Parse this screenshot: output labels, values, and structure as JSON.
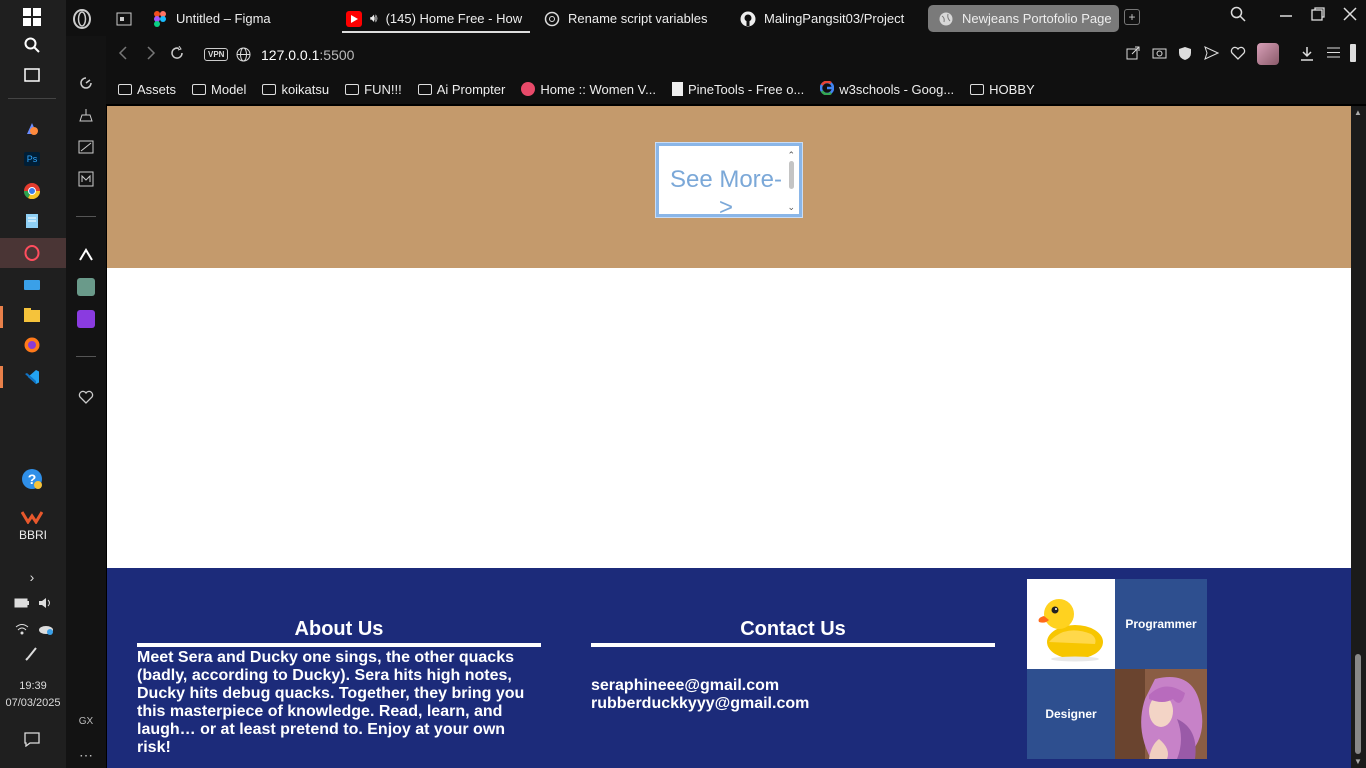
{
  "taskbar": {
    "time": "19:39",
    "date": "07/03/2025",
    "bbri_label": "BBRI"
  },
  "browser": {
    "tabs": [
      {
        "label": "Untitled – Figma",
        "icon": "figma-icon"
      },
      {
        "label": "(145) Home Free - How",
        "icon": "youtube-icon"
      },
      {
        "label": "Rename script variables",
        "icon": "chatgpt-icon"
      },
      {
        "label": "MalingPangsit03/Project",
        "icon": "github-icon"
      },
      {
        "label": "Newjeans Portofolio Page",
        "icon": "globe-icon"
      }
    ],
    "address": {
      "vpn": "VPN",
      "host": "127.0.0.1",
      "port": ":5500"
    },
    "bookmarks": [
      {
        "label": "Assets",
        "icon": "folder-icon"
      },
      {
        "label": "Model",
        "icon": "folder-icon"
      },
      {
        "label": "koikatsu",
        "icon": "folder-icon"
      },
      {
        "label": "FUN!!!",
        "icon": "folder-icon"
      },
      {
        "label": "Ai Prompter",
        "icon": "folder-icon"
      },
      {
        "label": "Home :: Women V...",
        "icon": "site-icon"
      },
      {
        "label": "PineTools - Free o...",
        "icon": "document-icon"
      },
      {
        "label": "w3schools - Goog...",
        "icon": "google-icon"
      },
      {
        "label": "HOBBY",
        "icon": "folder-icon"
      }
    ],
    "sidebar_gx": "GX"
  },
  "page": {
    "see_more": "See More->",
    "about": {
      "title": "About Us",
      "text": "Meet Sera and Ducky one sings, the other quacks (badly, according to Ducky). Sera hits high notes, Ducky hits debug quacks. Together, they bring you this masterpiece of knowledge. Read, learn, and laugh… or at least pretend to. Enjoy at your own risk!"
    },
    "contact": {
      "title": "Contact Us",
      "emails": [
        "seraphineee@gmail.com",
        "rubberduckkyyy@gmail.com"
      ]
    },
    "grid": {
      "programmer": "Programmer",
      "designer": "Designer"
    }
  },
  "colors": {
    "tan": "#c49a6c",
    "footer": "#1c2b7a",
    "tile_blue": "#2e4f8f"
  }
}
